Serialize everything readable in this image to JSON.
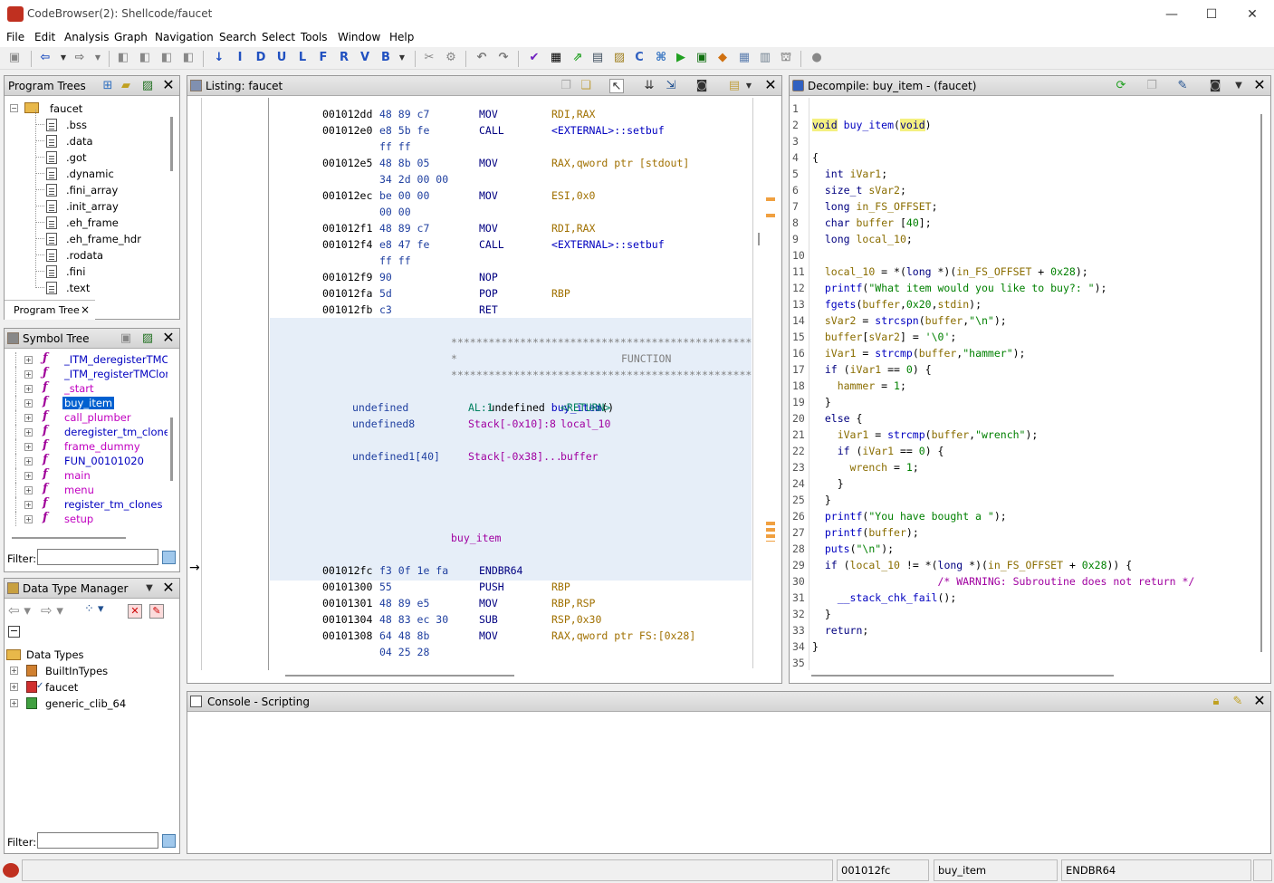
{
  "window": {
    "title": "CodeBrowser(2): Shellcode/faucet",
    "min": "—",
    "max": "☐",
    "close": "✕"
  },
  "menu": [
    "File",
    "Edit",
    "Analysis",
    "Graph",
    "Navigation",
    "Search",
    "Select",
    "Tools",
    "Window",
    "Help"
  ],
  "toolbar": {
    "letters": [
      "I",
      "D",
      "U",
      "L",
      "F",
      "R",
      "V",
      "B"
    ]
  },
  "program_trees": {
    "title": "Program Trees",
    "root": "faucet",
    "sections": [
      ".bss",
      ".data",
      ".got",
      ".dynamic",
      ".fini_array",
      ".init_array",
      ".eh_frame",
      ".eh_frame_hdr",
      ".rodata",
      ".fini",
      ".text"
    ],
    "tab": "Program Tree",
    "tab_close": "×"
  },
  "symbol_tree": {
    "title": "Symbol Tree",
    "items": [
      {
        "name": "_ITM_deregisterTMClor",
        "color": "blue"
      },
      {
        "name": "_ITM_registerTMCloneT",
        "color": "blue"
      },
      {
        "name": "_start",
        "color": "magenta"
      },
      {
        "name": "buy_item",
        "color": "selected"
      },
      {
        "name": "call_plumber",
        "color": "magenta"
      },
      {
        "name": "deregister_tm_clones",
        "color": "blue"
      },
      {
        "name": "frame_dummy",
        "color": "magenta"
      },
      {
        "name": "FUN_00101020",
        "color": "blue"
      },
      {
        "name": "main",
        "color": "magenta"
      },
      {
        "name": "menu",
        "color": "magenta"
      },
      {
        "name": "register_tm_clones",
        "color": "blue"
      },
      {
        "name": "setup",
        "color": "magenta"
      }
    ],
    "filter_label": "Filter:"
  },
  "data_type_manager": {
    "title": "Data Type Manager",
    "root": "Data Types",
    "items": [
      "BuiltInTypes",
      "faucet",
      "generic_clib_64"
    ],
    "filter_label": "Filter:"
  },
  "listing": {
    "title": "Listing:  faucet",
    "rows_top": [
      {
        "addr": "001012dd",
        "bytes": "48 89 c7",
        "mnem": "MOV",
        "ops": "RDI,RAX"
      },
      {
        "addr": "001012e0",
        "bytes": "e8 5b fe",
        "mnem": "CALL",
        "ops": "<EXTERNAL>::setbuf"
      },
      {
        "addr": "",
        "bytes": "ff ff",
        "mnem": "",
        "ops": ""
      },
      {
        "addr": "001012e5",
        "bytes": "48 8b 05",
        "mnem": "MOV",
        "ops": "RAX,qword ptr [stdout]"
      },
      {
        "addr": "",
        "bytes": "34 2d 00 00",
        "mnem": "",
        "ops": ""
      },
      {
        "addr": "001012ec",
        "bytes": "be 00 00",
        "mnem": "MOV",
        "ops": "ESI,0x0"
      },
      {
        "addr": "",
        "bytes": "00 00",
        "mnem": "",
        "ops": ""
      },
      {
        "addr": "001012f1",
        "bytes": "48 89 c7",
        "mnem": "MOV",
        "ops": "RDI,RAX"
      },
      {
        "addr": "001012f4",
        "bytes": "e8 47 fe",
        "mnem": "CALL",
        "ops": "<EXTERNAL>::setbuf"
      },
      {
        "addr": "",
        "bytes": "ff ff",
        "mnem": "",
        "ops": ""
      },
      {
        "addr": "001012f9",
        "bytes": "90",
        "mnem": "NOP",
        "ops": ""
      },
      {
        "addr": "001012fa",
        "bytes": "5d",
        "mnem": "POP",
        "ops": "RBP"
      },
      {
        "addr": "001012fb",
        "bytes": "c3",
        "mnem": "RET",
        "ops": ""
      }
    ],
    "stars": "**************************************************************",
    "function_label": "FUNCTION",
    "star_prefix": "*",
    "signature_pre": "undefined ",
    "signature_name": "buy_item",
    "signature_post": "()",
    "params": [
      {
        "type": "undefined",
        "loc": "AL:1",
        "name": "<RETURN>"
      },
      {
        "type": "undefined8",
        "loc": "Stack[-0x10]:8",
        "name": "local_10"
      },
      {
        "type": "undefined1[40]",
        "loc": "Stack[-0x38]...",
        "name": "buffer"
      }
    ],
    "label": "buy_item",
    "rows_bottom": [
      {
        "addr": "001012fc",
        "bytes": "f3 0f 1e fa",
        "mnem": "ENDBR64",
        "ops": ""
      },
      {
        "addr": "00101300",
        "bytes": "55",
        "mnem": "PUSH",
        "ops": "RBP"
      },
      {
        "addr": "00101301",
        "bytes": "48 89 e5",
        "mnem": "MOV",
        "ops": "RBP,RSP"
      },
      {
        "addr": "00101304",
        "bytes": "48 83 ec 30",
        "mnem": "SUB",
        "ops": "RSP,0x30"
      },
      {
        "addr": "00101308",
        "bytes": "64 48 8b",
        "mnem": "MOV",
        "ops": "RAX,qword ptr FS:[0x28]"
      },
      {
        "addr": "",
        "bytes": "04 25 28",
        "mnem": "",
        "ops": ""
      }
    ]
  },
  "decompile": {
    "title": "Decompile: buy_item -  (faucet)",
    "lines": [
      "",
      "void buy_item(void)",
      "",
      "{",
      "  int iVar1;",
      "  size_t sVar2;",
      "  long in_FS_OFFSET;",
      "  char buffer [40];",
      "  long local_10;",
      "  ",
      "  local_10 = *(long *)(in_FS_OFFSET + 0x28);",
      "  printf(\"What item would you like to buy?: \");",
      "  fgets(buffer,0x20,stdin);",
      "  sVar2 = strcspn(buffer,\"\\n\");",
      "  buffer[sVar2] = '\\0';",
      "  iVar1 = strcmp(buffer,\"hammer\");",
      "  if (iVar1 == 0) {",
      "    hammer = 1;",
      "  }",
      "  else {",
      "    iVar1 = strcmp(buffer,\"wrench\");",
      "    if (iVar1 == 0) {",
      "      wrench = 1;",
      "    }",
      "  }",
      "  printf(\"You have bought a \");",
      "  printf(buffer);",
      "  puts(\"\\n\");",
      "  if (local_10 != *(long *)(in_FS_OFFSET + 0x28)) {",
      "                    /* WARNING: Subroutine does not return */",
      "    __stack_chk_fail();",
      "  }",
      "  return;",
      "}",
      ""
    ]
  },
  "console": {
    "title": "Console - Scripting"
  },
  "status": {
    "address": "001012fc",
    "function": "buy_item",
    "instruction": "ENDBR64"
  }
}
